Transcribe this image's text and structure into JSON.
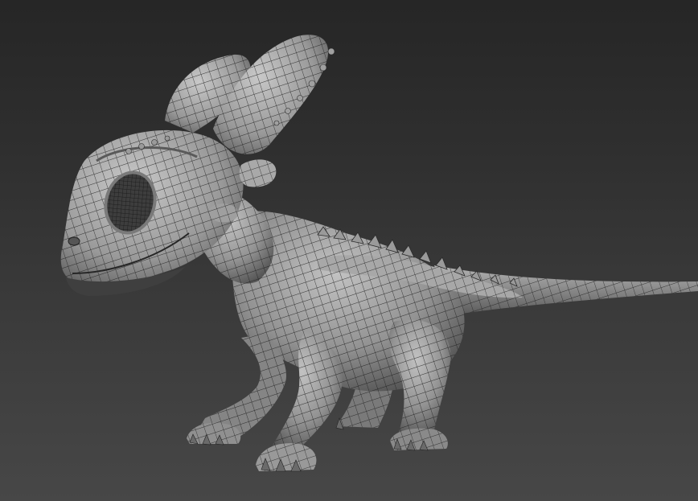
{
  "viewport": {
    "background_top": "#262626",
    "background_bottom": "#474747",
    "mesh_fill": "#8d8d8d",
    "mesh_light": "#b9b9b9",
    "mesh_shadow": "#3c3c3c",
    "wire_color": "#1c1c1c"
  },
  "model": {
    "subject": "baby-dragon",
    "display_mode": "wireframe-on-shaded"
  }
}
